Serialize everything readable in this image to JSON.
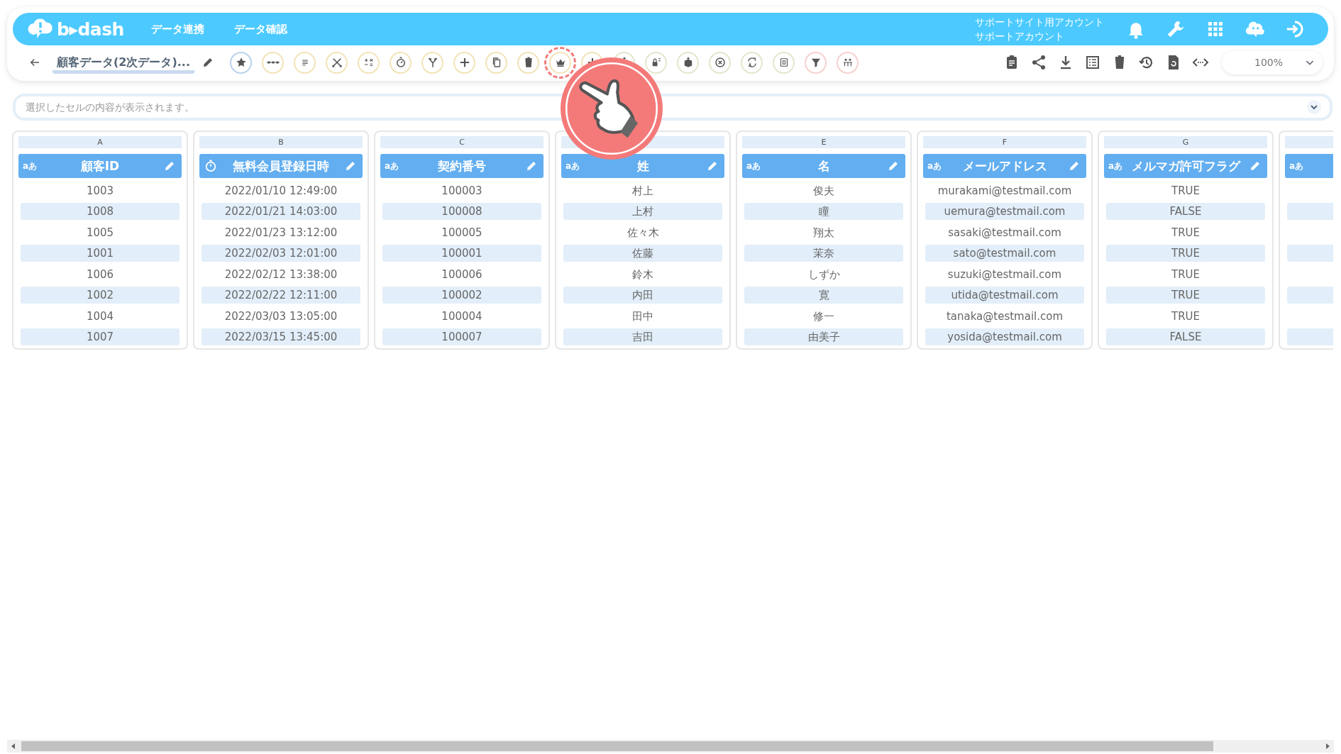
{
  "header": {
    "logo": "b▸dash",
    "nav": [
      {
        "label": "データ連携"
      },
      {
        "label": "データ確認"
      }
    ],
    "account": [
      "サポートサイト用アカウント",
      "サポートアカウント"
    ],
    "icons": [
      {
        "kind": "bell"
      },
      {
        "kind": "wrench"
      },
      {
        "kind": "apps"
      },
      {
        "kind": "cloud"
      },
      {
        "kind": "signin"
      }
    ]
  },
  "toolbar": {
    "title": "顧客データ(2次データ)...",
    "tools": [
      {
        "kind": "star",
        "color": "#b9d3ee",
        "highlighted": false
      },
      {
        "kind": "dots",
        "color": "#f3e3b8",
        "highlighted": false
      },
      {
        "kind": "lines",
        "color": "#f3e3b8",
        "highlighted": false
      },
      {
        "kind": "scissors",
        "color": "#f3e3b8",
        "highlighted": false
      },
      {
        "kind": "math",
        "color": "#f3e3b8",
        "highlighted": false
      },
      {
        "kind": "timer",
        "color": "#f3e3b8",
        "highlighted": false
      },
      {
        "kind": "branch",
        "color": "#f3e3b8",
        "highlighted": false
      },
      {
        "kind": "plus",
        "color": "#f3e3b8",
        "highlighted": false
      },
      {
        "kind": "copy",
        "color": "#f3e3b8",
        "highlighted": false
      },
      {
        "kind": "trash",
        "color": "#f3e3b8",
        "highlighted": false
      },
      {
        "kind": "crown",
        "color": "#f3e3b8",
        "highlighted": true
      },
      {
        "kind": "plus",
        "color": "#f3e3b8",
        "highlighted": false
      },
      {
        "kind": "box",
        "color": "#e2e8cc",
        "highlighted": false
      },
      {
        "kind": "lock",
        "color": "#e2e8cc",
        "highlighted": false
      },
      {
        "kind": "box",
        "color": "#e2e8cc",
        "highlighted": false
      },
      {
        "kind": "cross",
        "color": "#e2e8cc",
        "highlighted": false
      },
      {
        "kind": "swap",
        "color": "#e2e8cc",
        "highlighted": false
      },
      {
        "kind": "frame",
        "color": "#e2e8cc",
        "highlighted": false
      },
      {
        "kind": "filter",
        "color": "#f8d0d0",
        "highlighted": false
      },
      {
        "kind": "people",
        "color": "#f8d0d0",
        "highlighted": false
      }
    ],
    "right_tools": [
      {
        "kind": "clipboard"
      },
      {
        "kind": "share"
      },
      {
        "kind": "download"
      },
      {
        "kind": "list"
      },
      {
        "kind": "trash"
      },
      {
        "kind": "history"
      },
      {
        "kind": "restore"
      },
      {
        "kind": "code"
      }
    ],
    "zoom": "100%"
  },
  "formula_bar": {
    "placeholder": "選択したセルの内容が表示されます。"
  },
  "columns": [
    {
      "letter": "A",
      "kind": "text",
      "type_label": "aあ",
      "title": "顧客ID",
      "cells": [
        "1003",
        "1008",
        "1005",
        "1001",
        "1006",
        "1002",
        "1004",
        "1007"
      ]
    },
    {
      "letter": "B",
      "kind": "datetime",
      "title": "無料会員登録日時",
      "cells": [
        "2022/01/10 12:49:00",
        "2022/01/21 14:03:00",
        "2022/01/23 13:12:00",
        "2022/02/03 12:01:00",
        "2022/02/12 13:38:00",
        "2022/02/22 12:11:00",
        "2022/03/03 13:05:00",
        "2022/03/15 13:45:00"
      ]
    },
    {
      "letter": "C",
      "kind": "text",
      "type_label": "aあ",
      "title": "契約番号",
      "cells": [
        "100003",
        "100008",
        "100005",
        "100001",
        "100006",
        "100002",
        "100004",
        "100007"
      ]
    },
    {
      "kind": "text",
      "type_label": "aあ",
      "title": "姓",
      "cells": [
        "村上",
        "上村",
        "佐々木",
        "佐藤",
        "鈴木",
        "内田",
        "田中",
        "吉田"
      ]
    },
    {
      "letter": "E",
      "kind": "text",
      "type_label": "aあ",
      "title": "名",
      "cells": [
        "俊夫",
        "瞳",
        "翔太",
        "茉奈",
        "しずか",
        "寛",
        "修一",
        "由美子"
      ]
    },
    {
      "letter": "F",
      "kind": "text",
      "type_label": "aあ",
      "title": "メールアドレス",
      "cells": [
        "murakami@testmail.com",
        "uemura@testmail.com",
        "sasaki@testmail.com",
        "sato@testmail.com",
        "suzuki@testmail.com",
        "utida@testmail.com",
        "tanaka@testmail.com",
        "yosida@testmail.com"
      ]
    },
    {
      "letter": "G",
      "kind": "text",
      "type_label": "aあ",
      "title": "メルマガ許可フラグ",
      "cells": [
        "TRUE",
        "FALSE",
        "TRUE",
        "TRUE",
        "TRUE",
        "TRUE",
        "TRUE",
        "FALSE"
      ]
    },
    {
      "kind": "text",
      "type_label": "aあ",
      "partial": true
    }
  ]
}
